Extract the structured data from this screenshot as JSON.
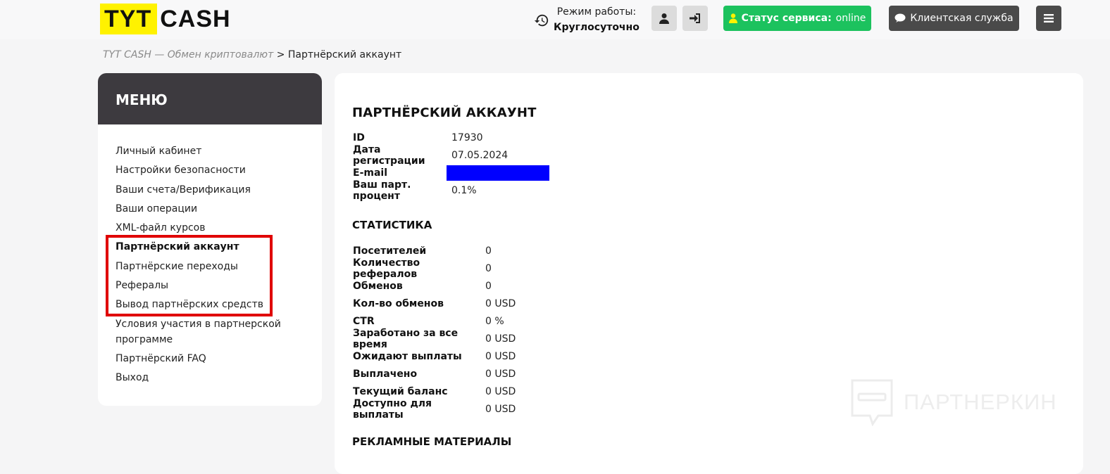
{
  "logo": {
    "part1": "TYT",
    "part2": "CASH"
  },
  "hours": {
    "label": "Режим работы:",
    "value": "Круглосуточно",
    "icon": "history-icon"
  },
  "header": {
    "user_icon": "user-icon",
    "login_icon": "sign-in-icon",
    "status_label": "Статус сервиса:",
    "status_value": "online",
    "support_label": "Клиентская служба",
    "menu_icon": "hamburger-icon"
  },
  "breadcrumb": {
    "link": "TYT CASH — Обмен криптовалют",
    "separator": ">",
    "current": "Партнёрский аккаунт"
  },
  "sidebar": {
    "title": "МЕНЮ",
    "items": [
      {
        "label": "Личный кабинет"
      },
      {
        "label": "Настройки безопасности"
      },
      {
        "label": "Ваши счета/Верификация"
      },
      {
        "label": "Ваши операции"
      },
      {
        "label": "XML-файл курсов"
      },
      {
        "label": "Партнёрский аккаунт",
        "active": true
      },
      {
        "label": "Партнёрские переходы"
      },
      {
        "label": "Рефералы"
      },
      {
        "label": "Вывод партнёрских средств"
      },
      {
        "label": "Условия участия в партнерской программе"
      },
      {
        "label": "Партнёрский FAQ"
      },
      {
        "label": "Выход"
      }
    ]
  },
  "account": {
    "title": "ПАРТНЁРСКИЙ АККАУНТ",
    "rows": [
      {
        "k": "ID",
        "v": "17930"
      },
      {
        "k": "Дата регистрации",
        "v": "07.05.2024"
      },
      {
        "k": "E-mail",
        "v": ""
      },
      {
        "k": "Ваш парт. процент",
        "v": "0.1%"
      }
    ]
  },
  "stats": {
    "title": "СТАТИСТИКА",
    "rows": [
      {
        "k": "Посетителей",
        "v": "0"
      },
      {
        "k": "Количество рефералов",
        "v": "0"
      },
      {
        "k": "Обменов",
        "v": "0"
      },
      {
        "k": "Кол-во обменов",
        "v": "0 USD"
      },
      {
        "k": "CTR",
        "v": "0 %"
      },
      {
        "k": "Заработано за все время",
        "v": "0 USD"
      },
      {
        "k": "Ожидают выплаты",
        "v": "0 USD"
      },
      {
        "k": "Выплачено",
        "v": "0 USD"
      },
      {
        "k": "Текущий баланс",
        "v": "0 USD"
      },
      {
        "k": "Доступно для выплаты",
        "v": "0 USD"
      }
    ]
  },
  "ads": {
    "title": "РЕКЛАМНЫЕ МАТЕРИАЛЫ"
  },
  "watermark": {
    "text": "ПАРТНЕРКИН"
  },
  "colors": {
    "logo_yellow": "#fff200",
    "status_green": "#1cc25e",
    "dark_button": "#4a4a4a",
    "menu_header": "#3d3a3f",
    "highlight_red": "#e00000",
    "email_mask": "#0000ff"
  }
}
